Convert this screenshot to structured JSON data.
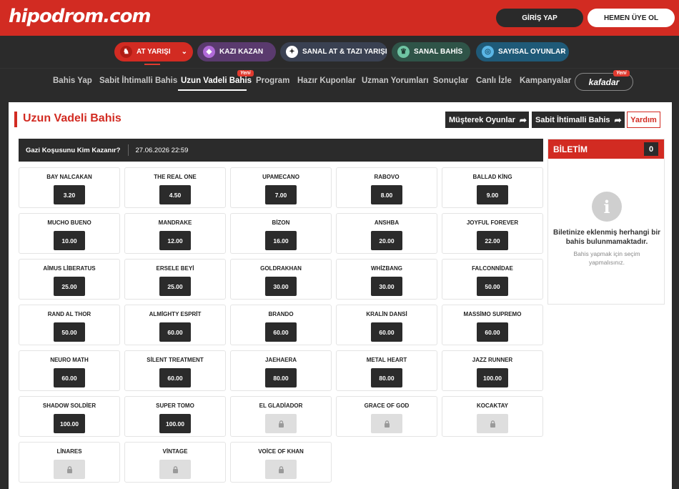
{
  "header": {
    "logo": "hipodrom.com",
    "login_label": "GİRİŞ YAP",
    "signup_label": "HEMEN ÜYE OL"
  },
  "categories": [
    {
      "label": "AT YARIŞI",
      "icon": "horse-icon",
      "color": "#d22b22"
    },
    {
      "label": "KAZI KAZAN",
      "icon": "diamond-icon",
      "color": "#5a3a6e"
    },
    {
      "label": "SANAL AT & TAZI YARIŞI",
      "icon": "virtual-race-icon",
      "color": "#3a4152"
    },
    {
      "label": "SANAL BAHİS",
      "icon": "trophy-icon",
      "color": "#2f5448"
    },
    {
      "label": "SAYISAL OYUNLAR",
      "icon": "lottery-icon",
      "color": "#1f5a78"
    }
  ],
  "nav": {
    "items": [
      "Bahis Yap",
      "Sabit İhtimalli Bahis",
      "Uzun Vadeli Bahis",
      "Program",
      "Hazır Kuponlar",
      "Uzman Yorumları",
      "Sonuçlar",
      "Canlı İzle",
      "Kampanyalar"
    ],
    "new_badge": "Yeni",
    "kafadar": "kafadar"
  },
  "page": {
    "title": "Uzun Vadeli Bahis",
    "btn_joint": "Müşterek Oyunlar",
    "btn_fixed": "Sabit İhtimalli Bahis",
    "btn_help": "Yardım"
  },
  "race": {
    "question": "Gazi Koşusunu Kim Kazanır?",
    "datetime": "27.06.2026 22:59"
  },
  "horses": [
    {
      "name": "BAY NALCAKAN",
      "odd": "3.20"
    },
    {
      "name": "THE REAL ONE",
      "odd": "4.50"
    },
    {
      "name": "UPAMECANO",
      "odd": "7.00"
    },
    {
      "name": "RABOVO",
      "odd": "8.00"
    },
    {
      "name": "BALLAD KİNG",
      "odd": "9.00"
    },
    {
      "name": "MUCHO BUENO",
      "odd": "10.00"
    },
    {
      "name": "MANDRAKE",
      "odd": "12.00"
    },
    {
      "name": "BİZON",
      "odd": "16.00"
    },
    {
      "name": "ANSHBA",
      "odd": "20.00"
    },
    {
      "name": "JOYFUL FOREVER",
      "odd": "22.00"
    },
    {
      "name": "AİMUS LİBERATUS",
      "odd": "25.00"
    },
    {
      "name": "ERSELE BEYİ",
      "odd": "25.00"
    },
    {
      "name": "GOLDRAKHAN",
      "odd": "30.00"
    },
    {
      "name": "WHİZBANG",
      "odd": "30.00"
    },
    {
      "name": "FALCONNİDAE",
      "odd": "50.00"
    },
    {
      "name": "RAND AL THOR",
      "odd": "50.00"
    },
    {
      "name": "ALMİGHTY ESPRİT",
      "odd": "60.00"
    },
    {
      "name": "BRANDO",
      "odd": "60.00"
    },
    {
      "name": "KRALİN DANSİ",
      "odd": "60.00"
    },
    {
      "name": "MASSİMO SUPREMO",
      "odd": "60.00"
    },
    {
      "name": "NEURO MATH",
      "odd": "60.00"
    },
    {
      "name": "SİLENT TREATMENT",
      "odd": "60.00"
    },
    {
      "name": "JAEHAERA",
      "odd": "80.00"
    },
    {
      "name": "METAL HEART",
      "odd": "80.00"
    },
    {
      "name": "JAZZ RUNNER",
      "odd": "100.00"
    },
    {
      "name": "SHADOW SOLDİER",
      "odd": "100.00"
    },
    {
      "name": "SUPER TOMO",
      "odd": "100.00"
    },
    {
      "name": "EL GLADİADOR",
      "odd": null
    },
    {
      "name": "GRACE OF GOD",
      "odd": null
    },
    {
      "name": "KOCAKTAY",
      "odd": null
    },
    {
      "name": "LİNARES",
      "odd": null
    },
    {
      "name": "VİNTAGE",
      "odd": null
    },
    {
      "name": "VOİCE OF KHAN",
      "odd": null
    }
  ],
  "betslip": {
    "title": "BİLETİM",
    "count": "0",
    "empty_msg": "Biletinize eklenmiş herhangi bir bahis bulunmamaktadır.",
    "empty_sub": "Bahis yapmak için seçim yapmalısınız."
  },
  "colors": {
    "brand": "#d22b22",
    "dark": "#2b2b2b"
  }
}
